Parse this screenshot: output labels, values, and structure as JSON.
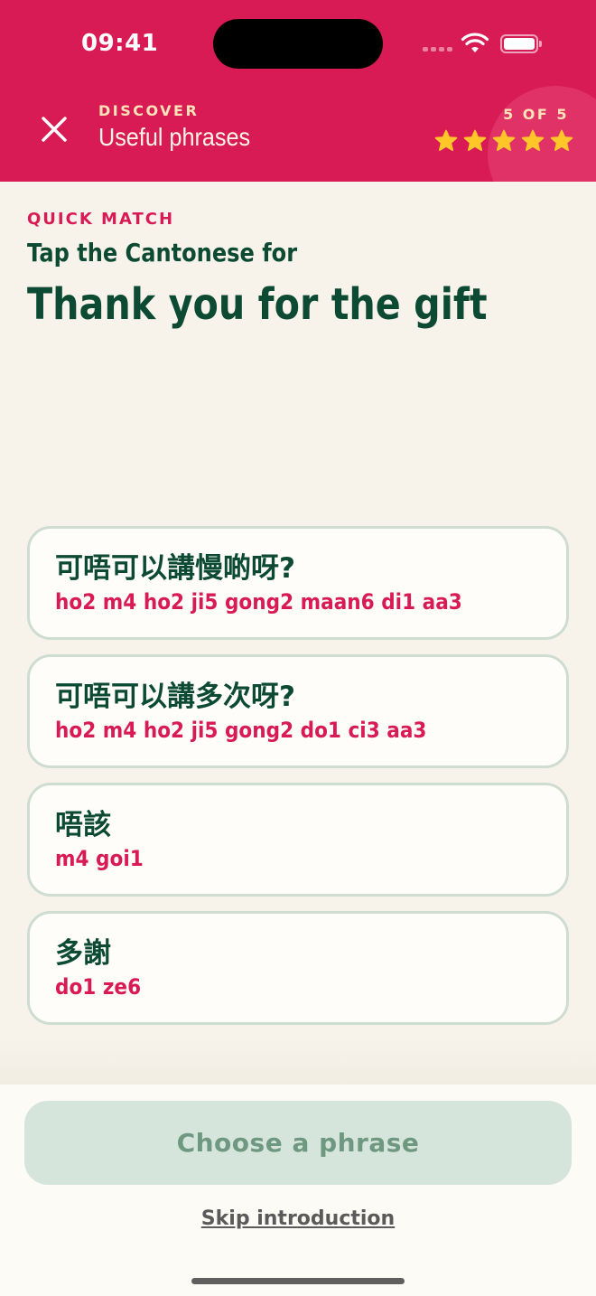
{
  "status_bar": {
    "time": "09:41"
  },
  "header": {
    "eyebrow": "DISCOVER",
    "title": "Useful phrases",
    "progress": "5 OF 5",
    "stars_filled": 5,
    "stars_total": 5,
    "icons": {
      "close": "close-icon",
      "star": "star-icon"
    },
    "colors": {
      "background": "#d81b55",
      "star": "#ffc629"
    }
  },
  "exercise": {
    "eyebrow": "QUICK MATCH",
    "prompt": "Tap the Cantonese for",
    "phrase": "Thank you for the gift"
  },
  "options": [
    {
      "han": "可唔可以講慢啲呀?",
      "jyutping": "ho2 m4 ho2 ji5 gong2 maan6 di1 aa3"
    },
    {
      "han": "可唔可以講多次呀?",
      "jyutping": "ho2 m4 ho2 ji5 gong2 do1 ci3 aa3"
    },
    {
      "han": "唔該",
      "jyutping": "m4 goi1"
    },
    {
      "han": "多謝",
      "jyutping": "do1 ze6"
    }
  ],
  "footer": {
    "primary_button": "Choose a phrase",
    "primary_disabled": true,
    "skip_link": "Skip introduction"
  }
}
